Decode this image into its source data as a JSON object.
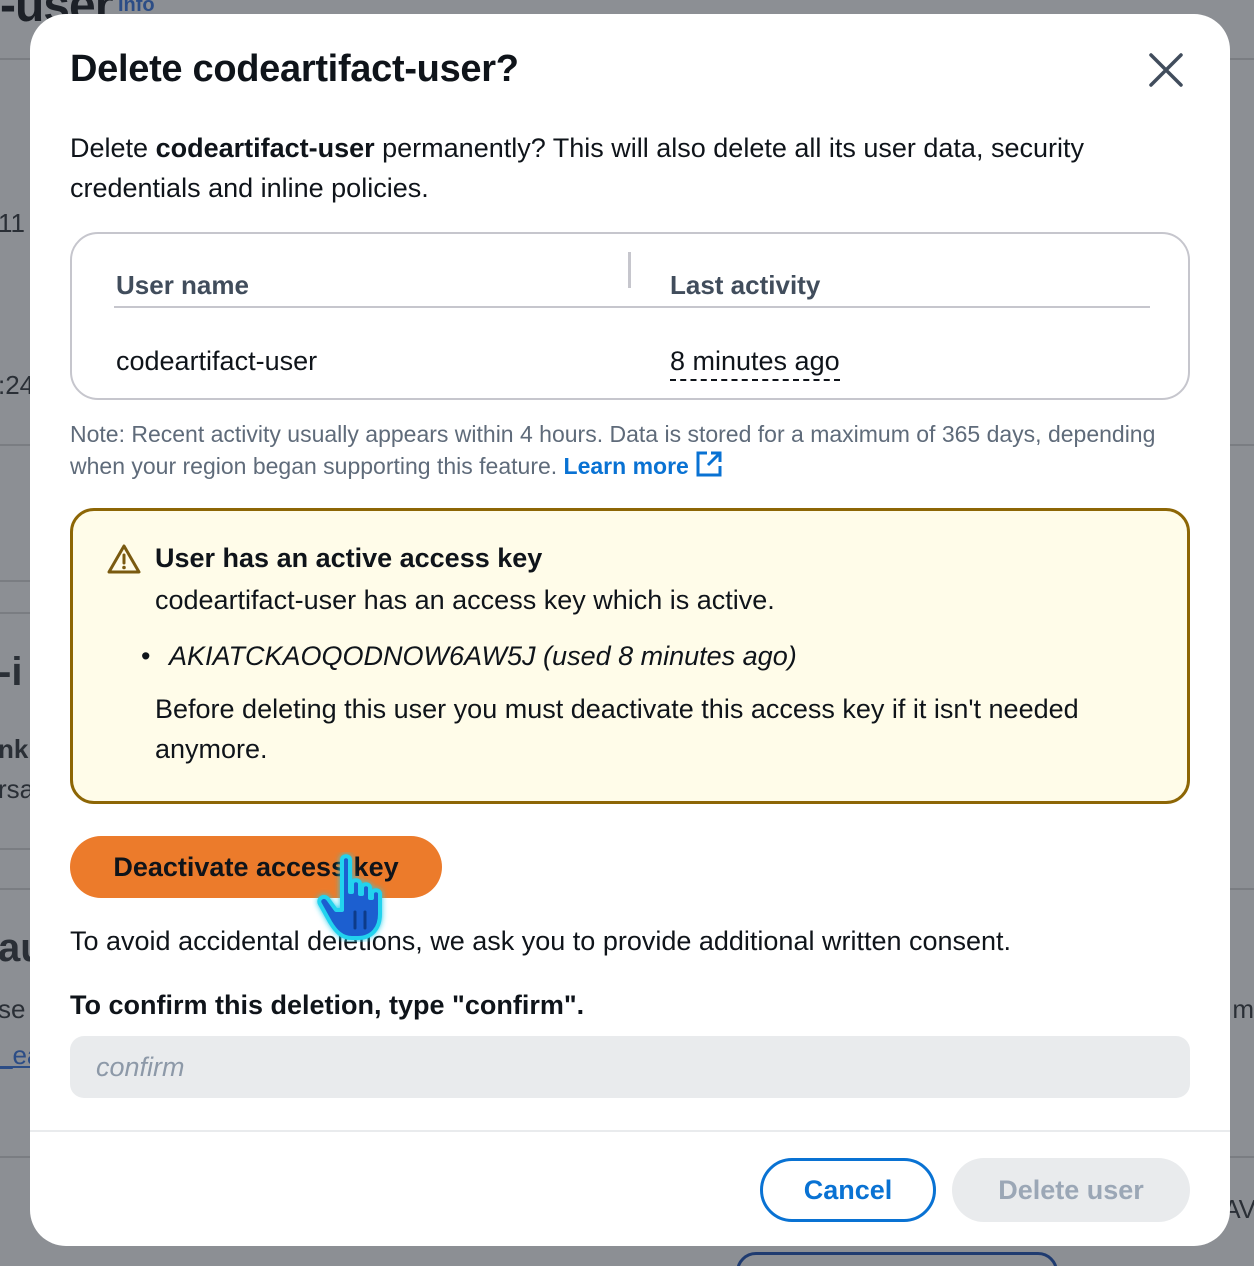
{
  "background": {
    "page_title_fragment": "-user",
    "info_link": "Info",
    "fragments": [
      {
        "text": "11"
      },
      {
        "text": ":24"
      },
      {
        "text": "-i"
      },
      {
        "text": "nk"
      },
      {
        "text": "rsa"
      },
      {
        "text": "au"
      },
      {
        "text": "se"
      },
      {
        "text": "_ea"
      },
      {
        "text": "m"
      },
      {
        "text": "AV"
      }
    ]
  },
  "modal": {
    "title": "Delete codeartifact-user?",
    "description_prefix": "Delete ",
    "description_user": "codeartifact-user",
    "description_suffix": " permanently? This will also delete all its user data, security credentials and inline policies.",
    "table": {
      "headers": [
        "User name",
        "Last activity"
      ],
      "row": {
        "user_name": "codeartifact-user",
        "last_activity": "8 minutes ago"
      }
    },
    "note": "Note: Recent activity usually appears within 4 hours. Data is stored for a maximum of 365 days, depending when your region began supporting this feature.",
    "learn_more": "Learn more",
    "warning": {
      "title": "User has an active access key",
      "text": "codeartifact-user has an access key which is active.",
      "bullet": "AKIATCKAOQODNOW6AW5J (used 8 minutes ago)",
      "after": "Before deleting this user you must deactivate this access key if it isn't needed anymore."
    },
    "deactivate_button": "Deactivate access key",
    "consent_text": "To avoid accidental deletions, we ask you to provide additional written consent.",
    "confirm_label": "To confirm this deletion, type \"confirm\".",
    "confirm_placeholder": "confirm",
    "confirm_value": "",
    "cancel_button": "Cancel",
    "delete_button": "Delete user"
  },
  "colors": {
    "primary_orange": "#ec7b2b",
    "link_blue": "#0972d3",
    "warning_border": "#8d6605",
    "warning_bg": "#fffce9",
    "disabled_bg": "#e9ebed"
  }
}
